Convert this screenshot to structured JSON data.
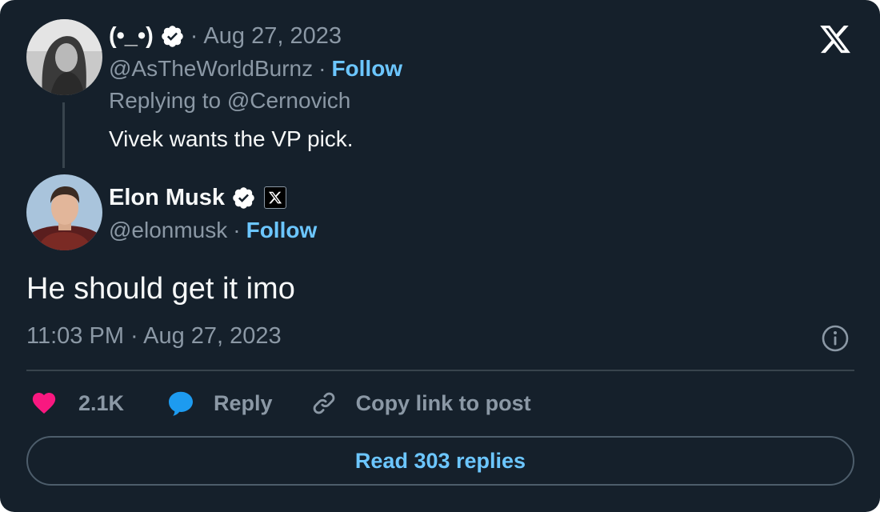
{
  "brand": {
    "logo_icon": "x-logo-icon",
    "background": "#15202b",
    "accent": "#6cc6ff",
    "like_color": "#f91880",
    "reply_color": "#1d9bf0"
  },
  "parent_tweet": {
    "display_name": "(•_•)",
    "verified": true,
    "date": "Aug 27, 2023",
    "handle": "@AsTheWorldBurnz",
    "follow_label": "Follow",
    "replying_to": "Replying to @Cernovich",
    "text": "Vivek wants the VP pick."
  },
  "main_tweet": {
    "display_name": "Elon Musk",
    "verified": true,
    "affiliation_icon": "x-affiliation-icon",
    "handle": "@elonmusk",
    "follow_label": "Follow",
    "text": "He should get it imo",
    "timestamp": "11:03 PM · Aug 27, 2023"
  },
  "actions": {
    "likes": "2.1K",
    "reply_label": "Reply",
    "copy_label": "Copy link to post"
  },
  "read_replies_label": "Read 303 replies",
  "separator": "·"
}
